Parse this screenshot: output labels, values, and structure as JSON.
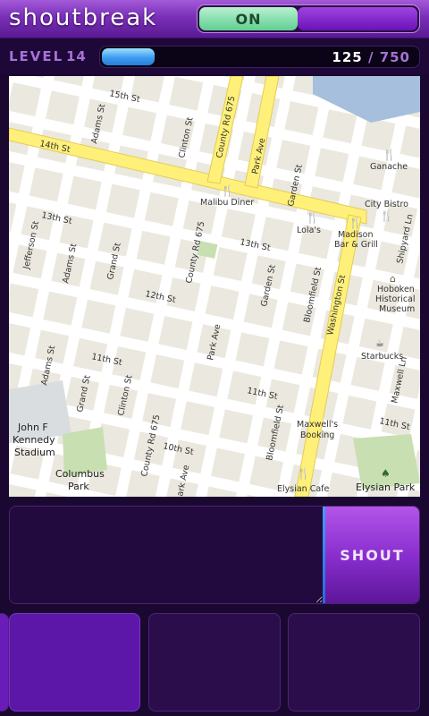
{
  "header": {
    "title": "shoutbreak",
    "toggle_label": "ON"
  },
  "level": {
    "label": "LEVEL",
    "number": "14",
    "xp_current": "125",
    "xp_separator": "/",
    "xp_max": "750",
    "progress_fraction": 0.167
  },
  "map": {
    "streets": {
      "s15th": "15th St",
      "s14th": "14th St",
      "s13th_left": "13th St",
      "s13th_mid": "13th St",
      "s12th": "12th St",
      "s11th_left": "11th St",
      "s11th_mid": "11th St",
      "s11th_right": "11th St",
      "s10th": "10th St",
      "adams_top": "Adams St",
      "adams_mid": "Adams St",
      "adams_low": "Adams St",
      "clinton_top": "Clinton St",
      "clinton_low": "Clinton St",
      "grand_mid": "Grand St",
      "grand_low": "Grand St",
      "jefferson": "Jefferson St",
      "county_top": "County Rd 675",
      "county_mid": "County Rd 675",
      "county_low": "County Rd 675",
      "park_top": "Park Ave",
      "park_mid": "Park Ave",
      "park_low": "ark Ave",
      "garden_top": "Garden St",
      "garden_mid": "Garden St",
      "bloomfield_mid": "Bloomfield St",
      "bloomfield_low": "Bloomfield St",
      "washington": "Washington St",
      "maxwell": "Maxwell Ln",
      "shipyard": "Shipyard Ln"
    },
    "places": {
      "ganache": "Ganache",
      "city_bistro": "City Bistro",
      "malibu": "Malibu Diner",
      "lolas": "Lola's",
      "madison_1": "Madison",
      "madison_2": "Bar & Grill",
      "hoboken_1": "Hoboken",
      "hoboken_2": "Historical",
      "hoboken_3": "Museum",
      "starbucks": "Starbucks",
      "maxwells_1": "Maxwell's",
      "maxwells_2": "Booking",
      "elysian_cafe": "Elysian Cafe",
      "elysian_park": "Elysian Park",
      "jfk_1": "John F",
      "jfk_2": "Kennedy",
      "jfk_3": "Stadium",
      "columbus_1": "Columbus",
      "columbus_2": "Park"
    }
  },
  "shout": {
    "input_placeholder": "",
    "button_label": "SHOUT"
  },
  "colors": {
    "accent_purple": "#8a2fcf",
    "xp_blue": "#3c9cf0",
    "toggle_green": "#5fcf90",
    "major_road_yellow": "#fff07a"
  }
}
